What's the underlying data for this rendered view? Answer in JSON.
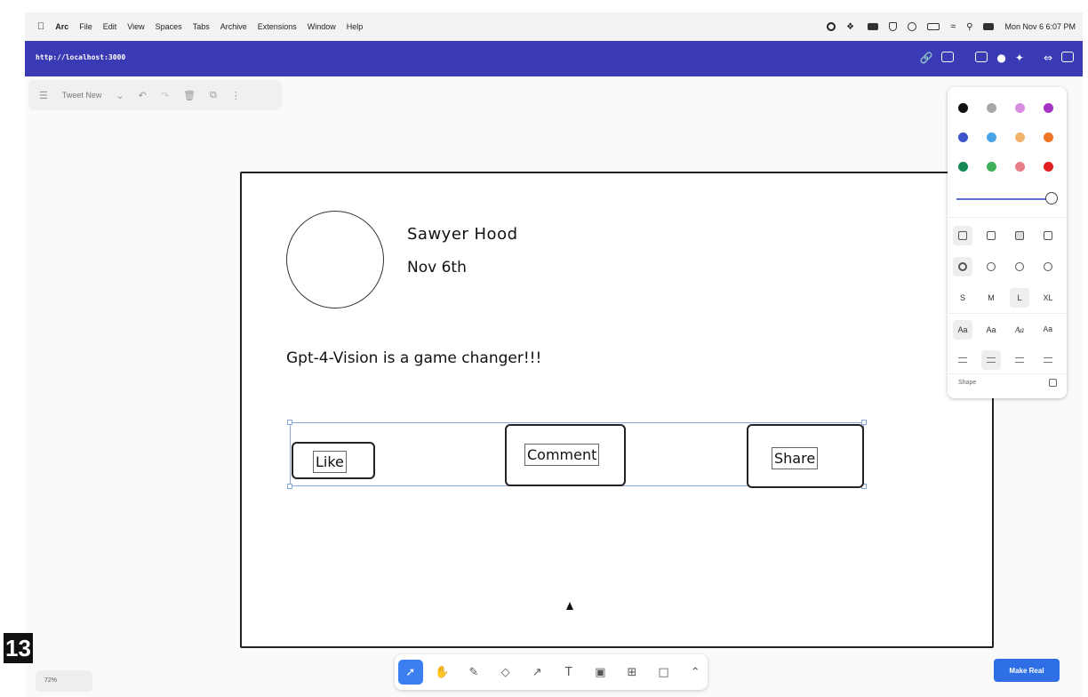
{
  "menubar": {
    "app": "Arc",
    "items": [
      "File",
      "Edit",
      "View",
      "Spaces",
      "Tabs",
      "Archive",
      "Extensions",
      "Window",
      "Help"
    ],
    "datetime": "Mon Nov 6  6:07 PM"
  },
  "browser": {
    "url": "http://localhost:3000"
  },
  "canvas_toolbar": {
    "page_name": "Tweet New"
  },
  "tweet": {
    "author": "Sawyer Hood",
    "date": "Nov 6th",
    "text": "Gpt-4-Vision is a game changer!!!",
    "like": "Like",
    "comment": "Comment",
    "share": "Share"
  },
  "style_panel": {
    "colors": [
      "#111111",
      "#a8a8a8",
      "#d78ee0",
      "#a534c6",
      "#3b55c8",
      "#4aa3e6",
      "#f2b36b",
      "#ee7523",
      "#148a57",
      "#3fb05a",
      "#e87e86",
      "#e02020"
    ],
    "selected_color": "#111111",
    "sizes": [
      "S",
      "M",
      "L",
      "XL"
    ],
    "selected_size": "L",
    "font_label": "Aa",
    "shape_label": "Shape"
  },
  "zoom": "72%",
  "make_real": "Make Real",
  "overlay_number": "13"
}
